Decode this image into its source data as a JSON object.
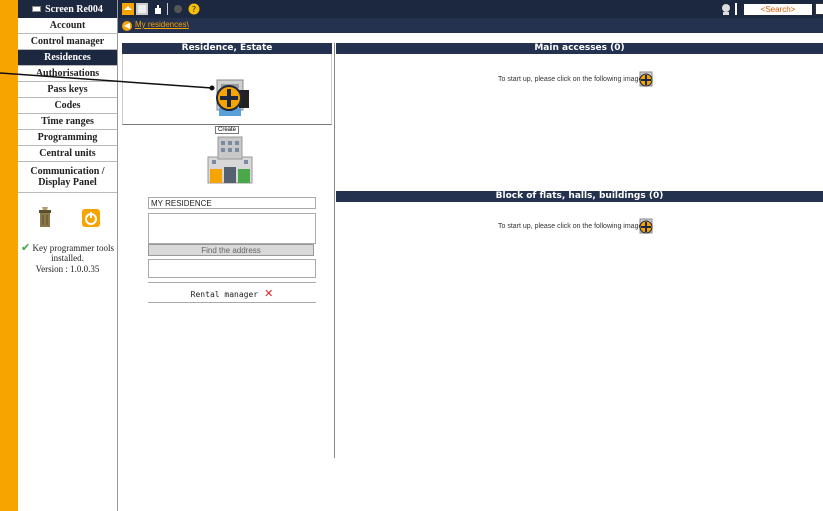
{
  "sidebar": {
    "title": "Screen Re004",
    "items": [
      {
        "label": "Account"
      },
      {
        "label": "Control manager"
      },
      {
        "label": "Residences"
      },
      {
        "label": "Authorisations"
      },
      {
        "label": "Pass keys"
      },
      {
        "label": "Codes"
      },
      {
        "label": "Time ranges"
      },
      {
        "label": "Programming"
      },
      {
        "label": "Central units"
      },
      {
        "label": "Communication / Display Panel"
      }
    ],
    "active_item": "Residences",
    "key_status": "Key programmer tools installed.",
    "version": "Version : 1.0.0.35"
  },
  "topbar": {
    "search_placeholder": "<Search>"
  },
  "breadcrumb": {
    "path": "My residences\\"
  },
  "residence_panel": {
    "header": "Residence, Estate",
    "create_tooltip": "Create",
    "name_value": "MY RESIDENCE",
    "find_address_label": "Find the address",
    "rental_manager_label": "Rental manager"
  },
  "main_accesses": {
    "header": "Main accesses (0)",
    "startup_text": "To start up, please click on the following image"
  },
  "blocks": {
    "header": "Block of flats, halls, buildings (0)",
    "startup_text": "To start up, please click on the following image"
  },
  "colors": {
    "accent": "#f7a400",
    "navy": "#1c2740",
    "header": "#24324f"
  }
}
